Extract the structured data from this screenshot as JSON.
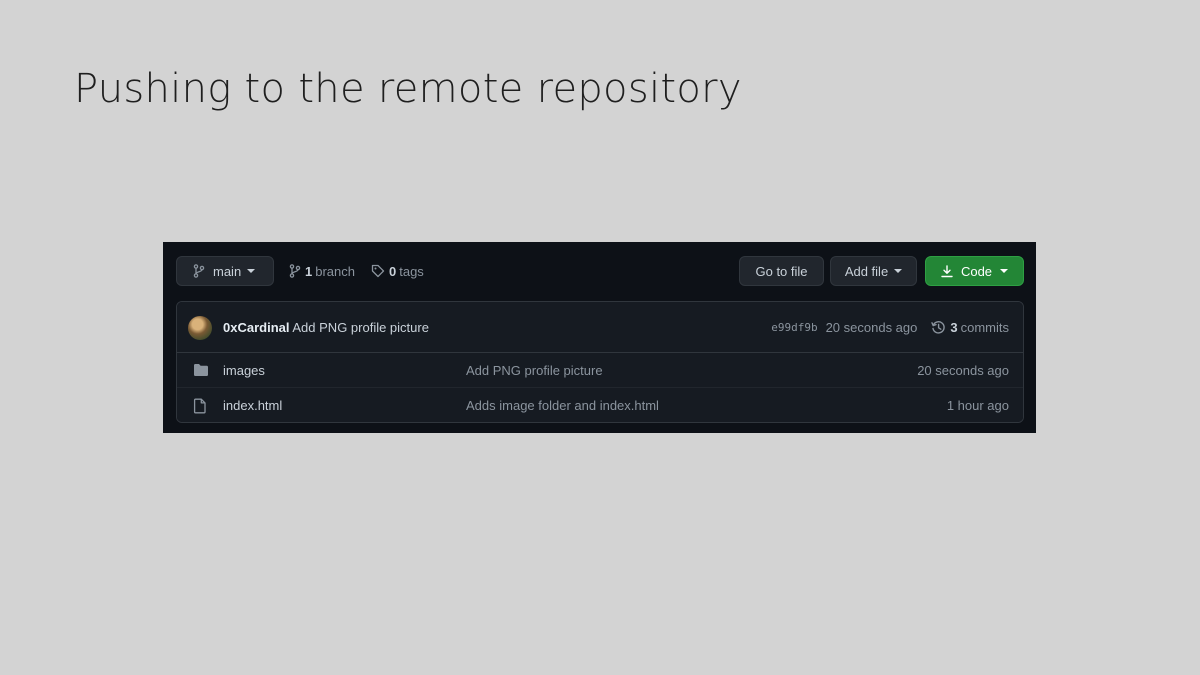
{
  "slide": {
    "title": "Pushing to the remote repository"
  },
  "toolbar": {
    "branch_selector": "main",
    "branch_count": "1",
    "branch_label": "branch",
    "tag_count": "0",
    "tag_label": "tags",
    "go_to_file": "Go to file",
    "add_file": "Add file",
    "code": "Code"
  },
  "latest_commit": {
    "author": "0xCardinal",
    "message": "Add PNG profile picture",
    "sha": "e99df9b",
    "age": "20 seconds ago",
    "commit_count": "3",
    "commit_label": "commits"
  },
  "files": [
    {
      "type": "folder",
      "icon": "folder-icon",
      "name": "images",
      "message": "Add PNG profile picture",
      "age": "20 seconds ago"
    },
    {
      "type": "file",
      "icon": "file-icon",
      "name": "index.html",
      "message": "Adds image folder and index.html",
      "age": "1 hour ago"
    }
  ],
  "colors": {
    "slide_background": "#d3d3d3",
    "panel_background": "#0d1117",
    "code_button": "#238636",
    "folder_icon": "#8b949e"
  }
}
